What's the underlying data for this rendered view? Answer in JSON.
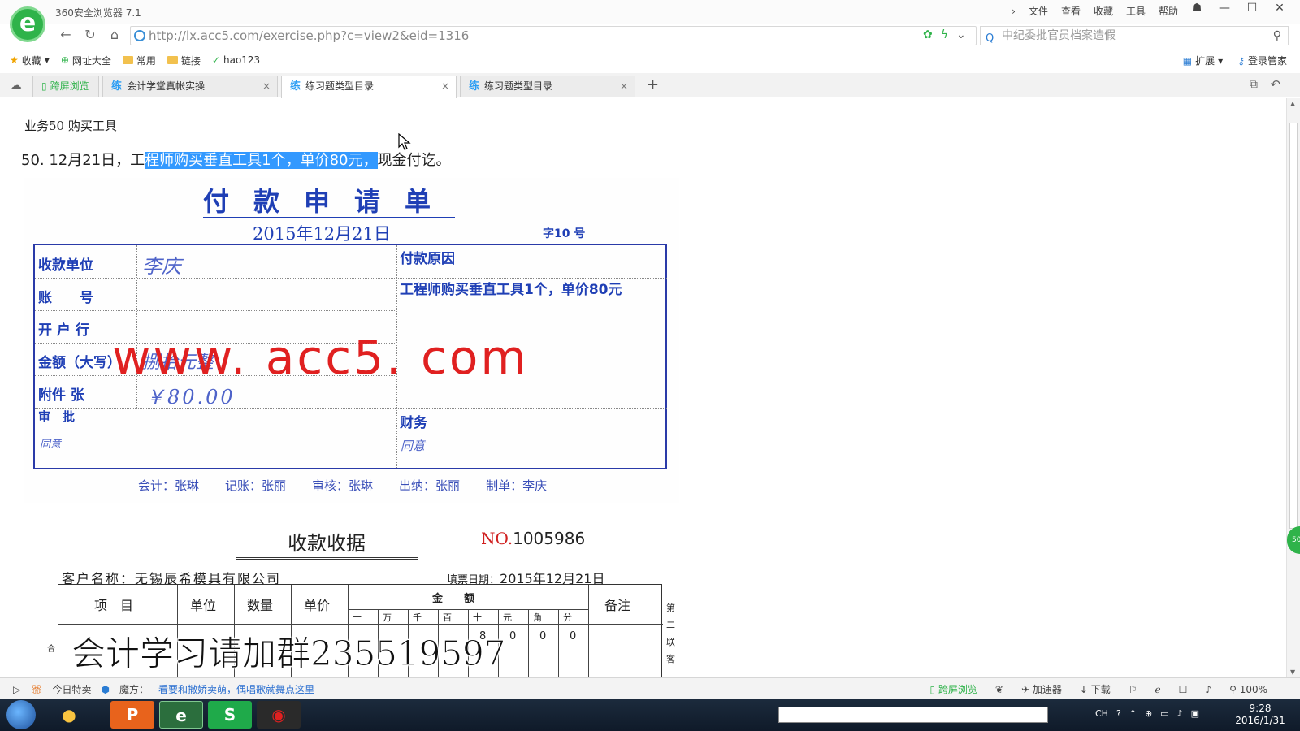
{
  "browser": {
    "title": "360安全浏览器 7.1",
    "logo_glyph": "e",
    "menu": [
      "文件",
      "查看",
      "收藏",
      "工具",
      "帮助"
    ],
    "url": "http://lx.acc5.com/exercise.php?c=view2&eid=1316",
    "search_placeholder": "中纪委批官员档案造假",
    "bookmarks": [
      "收藏",
      "网址大全",
      "常用",
      "链接",
      "hao123"
    ],
    "bookmarks_right": [
      "扩展",
      "登录管家"
    ],
    "tabs": [
      {
        "label": "跨屏浏览"
      },
      {
        "label": "会计学堂真帐实操"
      },
      {
        "label": "练习题类型目录"
      },
      {
        "label": "练习题类型目录"
      }
    ],
    "tab_icon": "练"
  },
  "page": {
    "business_title": "业务50  购买工具",
    "question_pre": "50. 12月21日，工",
    "question_highlight": "程师购买垂直工具1个，单价80元，",
    "question_post": "现金付讫。"
  },
  "payment_form": {
    "title": "付款申请单",
    "date": "2015年12月21日",
    "number": "字10 号",
    "labels": {
      "payee": "收款单位",
      "account": "账　　号",
      "bank": "开 户 行",
      "amount": "金额（大写）",
      "attachment": "附件  张",
      "approval": "审　批",
      "reason": "付款原因",
      "finance": "财务"
    },
    "values": {
      "payee": "李庆",
      "amount_words": "捌拾元整",
      "amount": "￥80.00",
      "reason": "工程师购买垂直工具1个，单价80元",
      "approval_sign": "同意",
      "finance_sign": "同意"
    },
    "footer": [
      "会计：张琳",
      "记账：张丽",
      "审核：张琳",
      "出纳：张丽",
      "制单：李庆"
    ]
  },
  "watermark": "www. acc5. com",
  "receipt": {
    "title": "收款收据",
    "no_label": "NO.",
    "no": "1005986",
    "customer": "客户名称：无锡辰希模具有限公司",
    "date_label": "填票日期：",
    "date": "2015年12月21日",
    "headers": [
      "项　目",
      "单位",
      "数量",
      "单价",
      "金　　额",
      "备注"
    ],
    "digit_headers": [
      "十",
      "万",
      "千",
      "百",
      "十",
      "元",
      "角",
      "分"
    ],
    "row_values": [
      "8",
      "0",
      "0",
      "0"
    ],
    "side_note": "第二联客",
    "row_label_partial": "合"
  },
  "overlay_text": "会计学习请加群235519597",
  "status": {
    "left": [
      "今日特卖",
      "魔方："
    ],
    "news": "看要和撒娇卖萌，偶唱歌就舞点这里",
    "right": [
      "跨屏浏览",
      "加速器",
      "下载",
      "100%"
    ]
  },
  "taskbar": {
    "clock_time": "9:28",
    "clock_date": "2016/1/31",
    "lang": "CH"
  },
  "colors": {
    "form_blue": "#1f3fb5",
    "highlight": "#3399ff",
    "watermark_red": "#e02020",
    "brand_green": "#2fb34a"
  }
}
